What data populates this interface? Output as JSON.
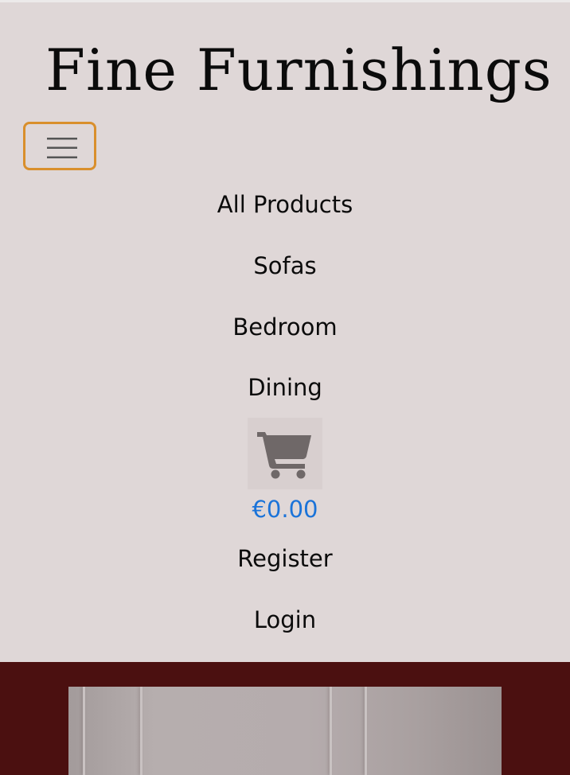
{
  "header": {
    "brand": "Fine Furnishings",
    "menu_toggle_icon": "hamburger-icon"
  },
  "nav": {
    "items": [
      {
        "label": "All Products"
      },
      {
        "label": "Sofas"
      },
      {
        "label": "Bedroom"
      },
      {
        "label": "Dining"
      }
    ],
    "cart": {
      "icon": "shopping-cart-icon",
      "total": "€0.00"
    },
    "account": [
      {
        "label": "Register"
      },
      {
        "label": "Login"
      }
    ]
  },
  "colors": {
    "header_bg": "#dfd7d7",
    "toggler_border": "#d98f2c",
    "cart_total": "#1a73d9",
    "hero_bg": "#4b1010"
  }
}
